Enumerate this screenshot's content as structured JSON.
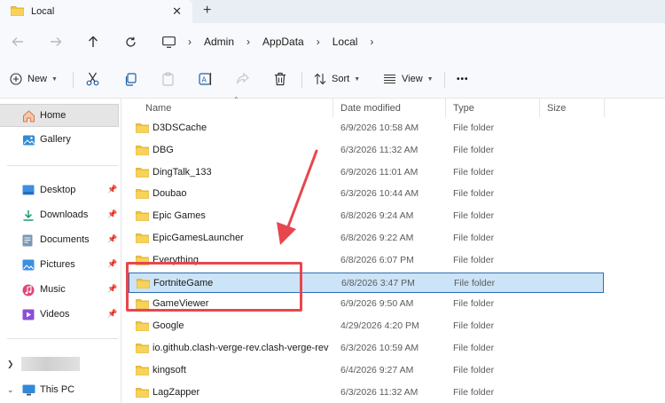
{
  "window": {
    "tab_title": "Local",
    "tab_close": "✕",
    "tab_new": "+"
  },
  "address": {
    "breadcrumbs": [
      "Admin",
      "AppData",
      "Local"
    ]
  },
  "toolbar": {
    "new_label": "New",
    "sort_label": "Sort",
    "view_label": "View",
    "more_label": "•••"
  },
  "sidebar": {
    "top_items": [
      {
        "label": "Home",
        "icon": "home-icon",
        "selected": true
      },
      {
        "label": "Gallery",
        "icon": "gallery-icon"
      }
    ],
    "pinned": [
      {
        "label": "Desktop",
        "icon": "desktop-folder-icon"
      },
      {
        "label": "Downloads",
        "icon": "downloads-folder-icon"
      },
      {
        "label": "Documents",
        "icon": "documents-folder-icon"
      },
      {
        "label": "Pictures",
        "icon": "pictures-folder-icon"
      },
      {
        "label": "Music",
        "icon": "music-folder-icon"
      },
      {
        "label": "Videos",
        "icon": "videos-folder-icon"
      }
    ],
    "this_pc": "This PC"
  },
  "columns": {
    "name": "Name",
    "date": "Date modified",
    "type": "Type",
    "size": "Size"
  },
  "files": [
    {
      "name": "D3DSCache",
      "date": "6/9/2026 10:58 AM",
      "type": "File folder"
    },
    {
      "name": "DBG",
      "date": "6/3/2026 11:32 AM",
      "type": "File folder"
    },
    {
      "name": "DingTalk_133",
      "date": "6/9/2026 11:01 AM",
      "type": "File folder"
    },
    {
      "name": "Doubao",
      "date": "6/3/2026 10:44 AM",
      "type": "File folder"
    },
    {
      "name": "Epic Games",
      "date": "6/8/2026 9:24 AM",
      "type": "File folder"
    },
    {
      "name": "EpicGamesLauncher",
      "date": "6/8/2026 9:22 AM",
      "type": "File folder"
    },
    {
      "name": "Everything",
      "date": "6/8/2026 6:07 PM",
      "type": "File folder"
    },
    {
      "name": "FortniteGame",
      "date": "6/8/2026 3:47 PM",
      "type": "File folder",
      "selected": true
    },
    {
      "name": "GameViewer",
      "date": "6/9/2026 9:50 AM",
      "type": "File folder"
    },
    {
      "name": "Google",
      "date": "4/29/2026 4:20 PM",
      "type": "File folder"
    },
    {
      "name": "io.github.clash-verge-rev.clash-verge-rev",
      "date": "6/3/2026 10:59 AM",
      "type": "File folder"
    },
    {
      "name": "kingsoft",
      "date": "6/4/2026 9:27 AM",
      "type": "File folder"
    },
    {
      "name": "LagZapper",
      "date": "6/3/2026 11:32 AM",
      "type": "File folder"
    }
  ],
  "colors": {
    "annotation": "#e8464d",
    "selection_fill": "#cce4f7",
    "selection_border": "#2d6fb3",
    "folder": "#f0c43a"
  }
}
